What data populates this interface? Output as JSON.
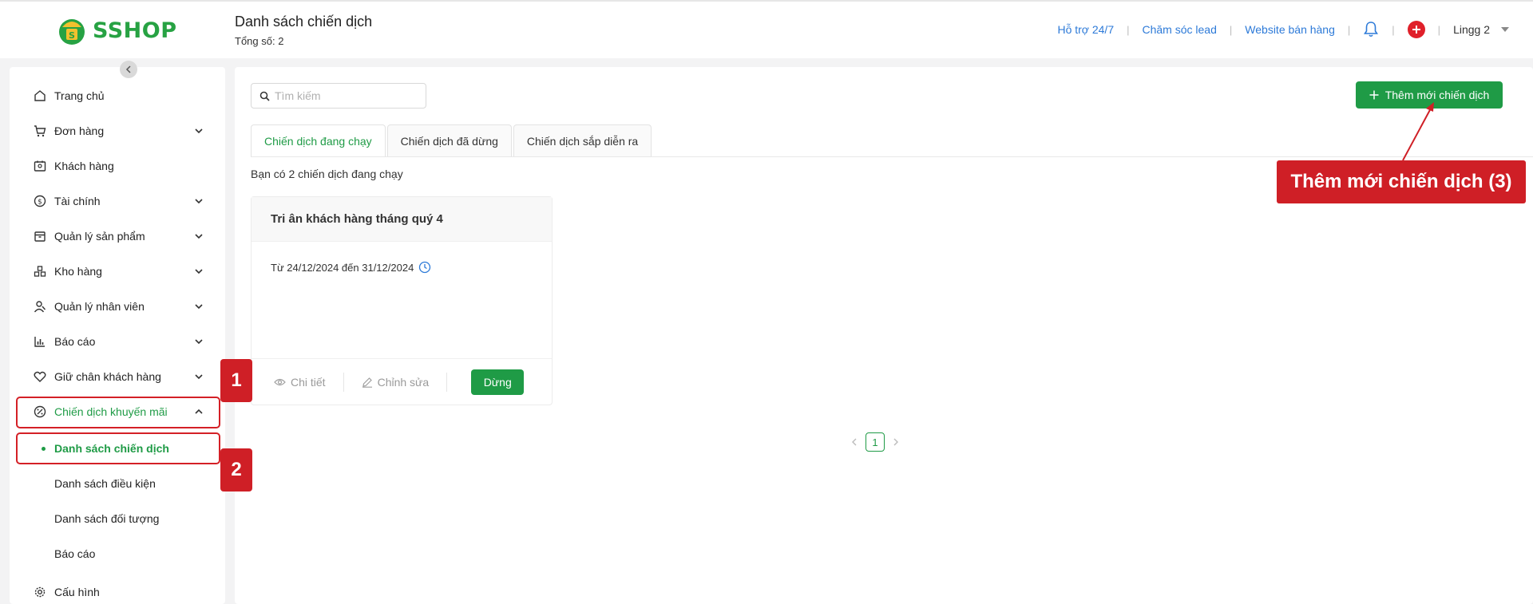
{
  "header": {
    "logo_text": "SSHOP",
    "title": "Danh sách chiến dịch",
    "subtitle": "Tổng số: 2",
    "links": [
      "Hỗ trợ 24/7",
      "Chăm sóc lead",
      "Website bán hàng"
    ],
    "user_name": "Lingg 2",
    "brand_color": "#27a243"
  },
  "sidebar": {
    "items": [
      {
        "label": "Trang chủ",
        "icon": "home-icon"
      },
      {
        "label": "Đơn hàng",
        "icon": "cart-icon"
      },
      {
        "label": "Khách hàng",
        "icon": "customer-card-icon"
      },
      {
        "label": "Tài chính",
        "icon": "dollar-circle-icon"
      },
      {
        "label": "Quản lý sản phẩm",
        "icon": "box-icon"
      },
      {
        "label": "Kho hàng",
        "icon": "warehouse-icon"
      },
      {
        "label": "Quản lý nhân viên",
        "icon": "staff-icon"
      },
      {
        "label": "Báo cáo",
        "icon": "bar-chart-icon"
      },
      {
        "label": "Giữ chân khách hàng",
        "icon": "heart-icon"
      },
      {
        "label": "Chiến dịch khuyến mãi",
        "icon": "discount-icon"
      },
      {
        "label": "Cấu hình",
        "icon": "gear-icon"
      }
    ],
    "subitems": [
      "Danh sách chiến dịch",
      "Danh sách điều kiện",
      "Danh sách đối tượng",
      "Báo cáo"
    ]
  },
  "main": {
    "search_placeholder": "Tìm kiếm",
    "add_button": "Thêm mới chiến dịch",
    "tabs": [
      "Chiến dịch đang chạy",
      "Chiến dịch đã dừng",
      "Chiến dịch sắp diễn ra"
    ],
    "count_text": "Bạn có 2 chiến dịch đang chạy",
    "card": {
      "title": "Tri ân khách hàng tháng quý 4",
      "date_range": "Từ 24/12/2024 đến 31/12/2024",
      "detail": "Chi tiết",
      "edit": "Chỉnh sửa",
      "stop": "Dừng"
    },
    "page": "1",
    "accent": "#1f9b46"
  },
  "annotations": {
    "badge_1": "1",
    "badge_2": "2",
    "callout": "Thêm mới chiến dịch (3)",
    "color": "#cf1f26"
  }
}
